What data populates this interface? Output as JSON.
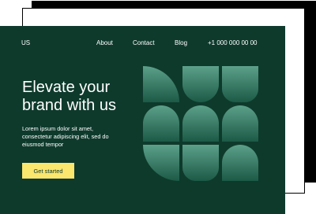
{
  "nav": {
    "logo": "US",
    "items": [
      "About",
      "Contact",
      "Blog"
    ],
    "phone": "+1 000 000 00 00"
  },
  "hero": {
    "headline_lines": [
      "Elevate your",
      "brand with us"
    ],
    "description_lines": [
      "Lorem ipsum dolor sit amet,",
      "consectetur adipiscing elit, sed do",
      "eiusmod tempor"
    ],
    "cta_label": "Get started"
  },
  "colors": {
    "background": "#0e3a2c",
    "cta": "#fbe66e",
    "shape_top": "#5ca08a",
    "shape_bottom": "#1c5a46"
  }
}
